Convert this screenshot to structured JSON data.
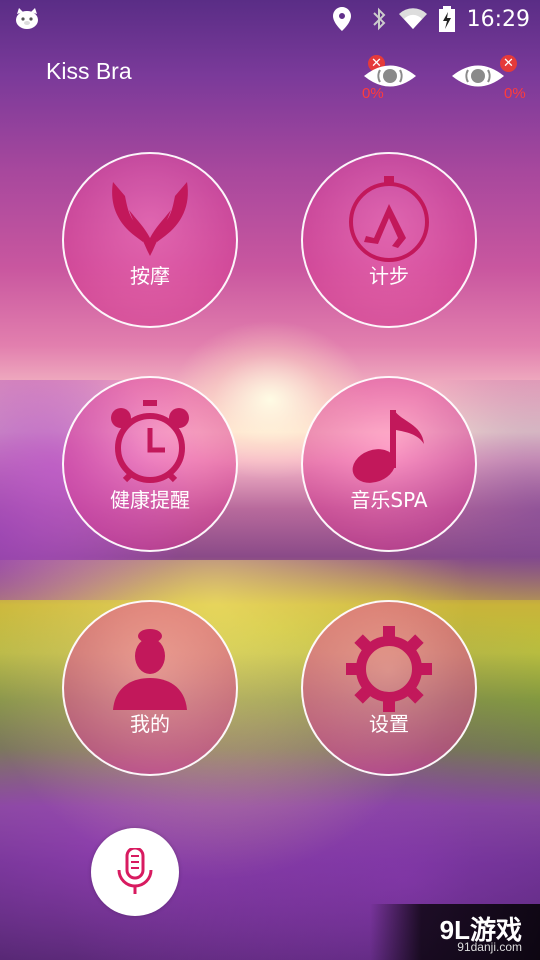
{
  "status_bar": {
    "time": "16:29",
    "icons": [
      "notification-app-icon",
      "location-icon",
      "bluetooth-icon",
      "wifi-icon",
      "battery-charging-icon"
    ]
  },
  "header": {
    "title": "Kiss Bra",
    "devices": [
      {
        "name": "device-left",
        "battery": "0%",
        "status": "disconnected"
      },
      {
        "name": "device-right",
        "battery": "0%",
        "status": "disconnected"
      }
    ],
    "colors": {
      "device_percent": "#ff3b3b",
      "disconnect_badge": "#e53a3a"
    }
  },
  "menu": [
    {
      "id": "massage",
      "label": "按摩",
      "icon": "hands-icon"
    },
    {
      "id": "pedometer",
      "label": "计步",
      "icon": "stopwatch-walking-icon"
    },
    {
      "id": "health-reminder",
      "label": "健康提醒",
      "icon": "alarm-clock-icon"
    },
    {
      "id": "music-spa",
      "label": "音乐SPA",
      "icon": "music-note-icon"
    },
    {
      "id": "me",
      "label": "我的",
      "icon": "user-profile-icon"
    },
    {
      "id": "settings",
      "label": "设置",
      "icon": "gear-icon"
    }
  ],
  "voice_button": {
    "icon": "microphone-icon"
  },
  "watermark": {
    "brand": "9L游戏",
    "site": "91danji.com"
  },
  "accent_color": "#c2185b"
}
